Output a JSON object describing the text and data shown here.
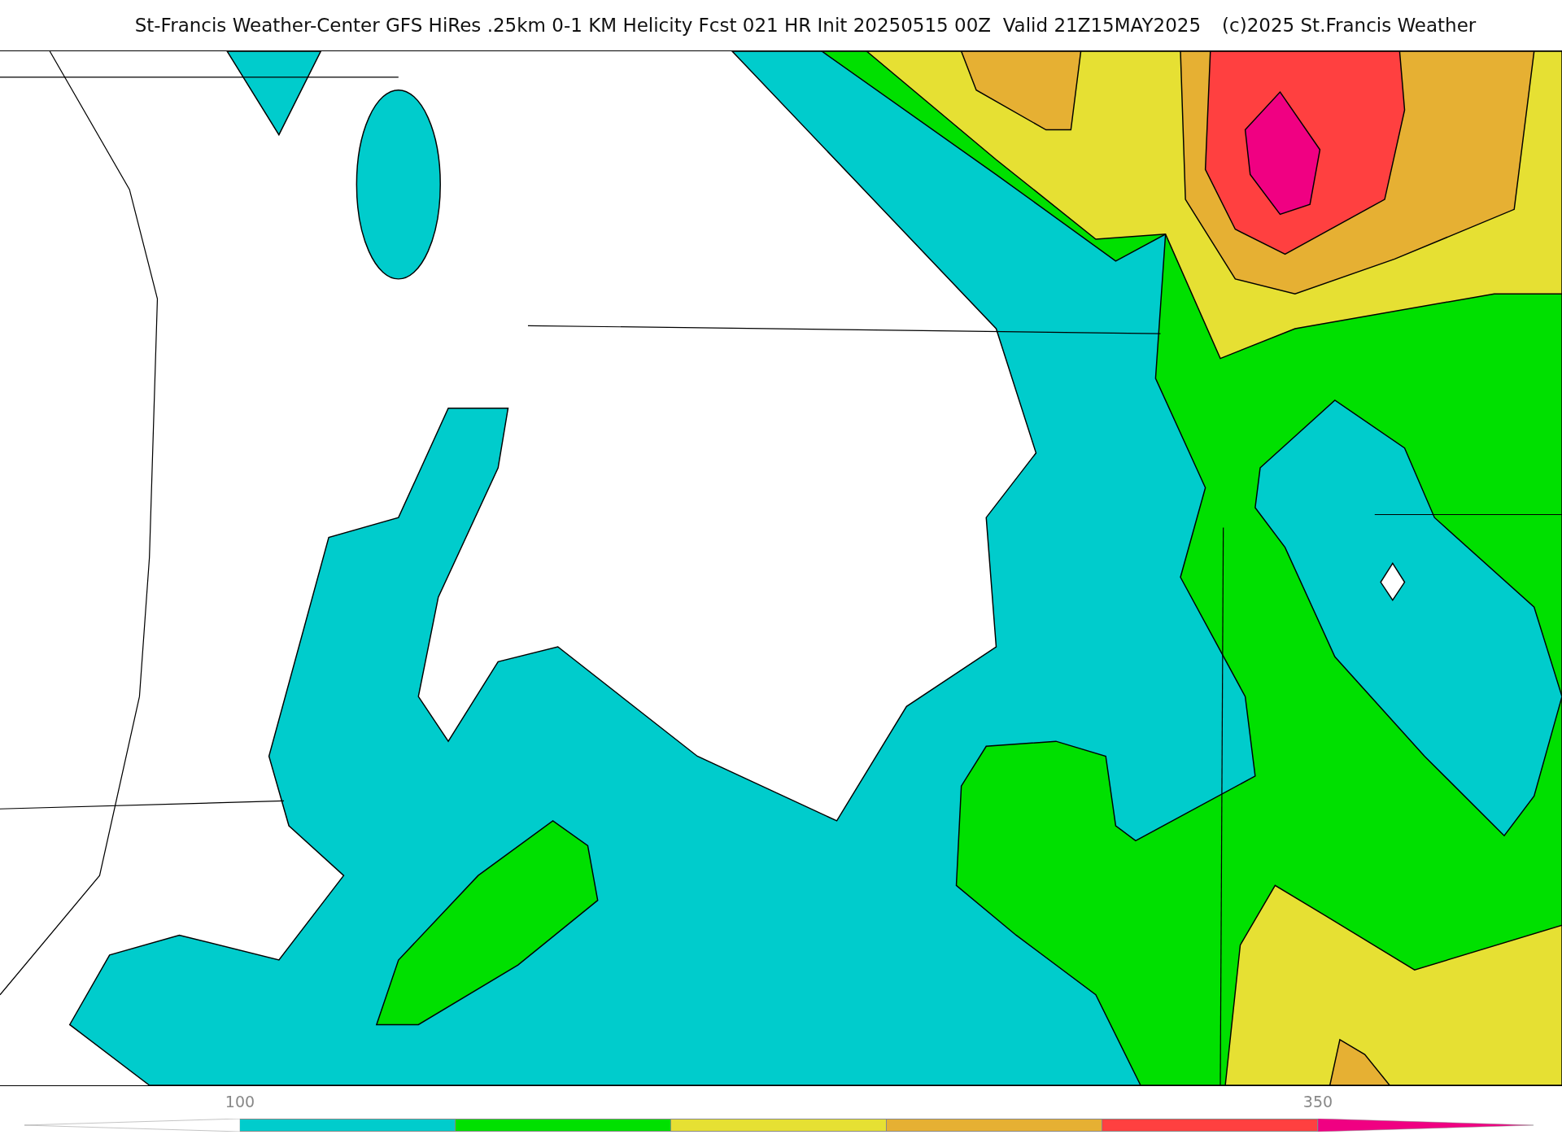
{
  "header": {
    "title": "St-Francis Weather-Center GFS HiRes .25km 0-1 KM Helicity Fcst 021 HR Init 20250515 00Z  Valid 21Z15MAY2025",
    "copyright": "(c)2025 St.Francis Weather"
  },
  "colorbar": {
    "segments": [
      {
        "kind": "extend-low",
        "color": "#ffffff"
      },
      {
        "kind": "fill",
        "color": "#00cccc",
        "tick": "100"
      },
      {
        "kind": "fill",
        "color": "#00e000"
      },
      {
        "kind": "fill",
        "color": "#e6e033"
      },
      {
        "kind": "fill",
        "color": "#e6b033"
      },
      {
        "kind": "fill",
        "color": "#ff4040"
      },
      {
        "kind": "extend-high",
        "color": "#f00082",
        "tick": "350"
      }
    ]
  }
}
